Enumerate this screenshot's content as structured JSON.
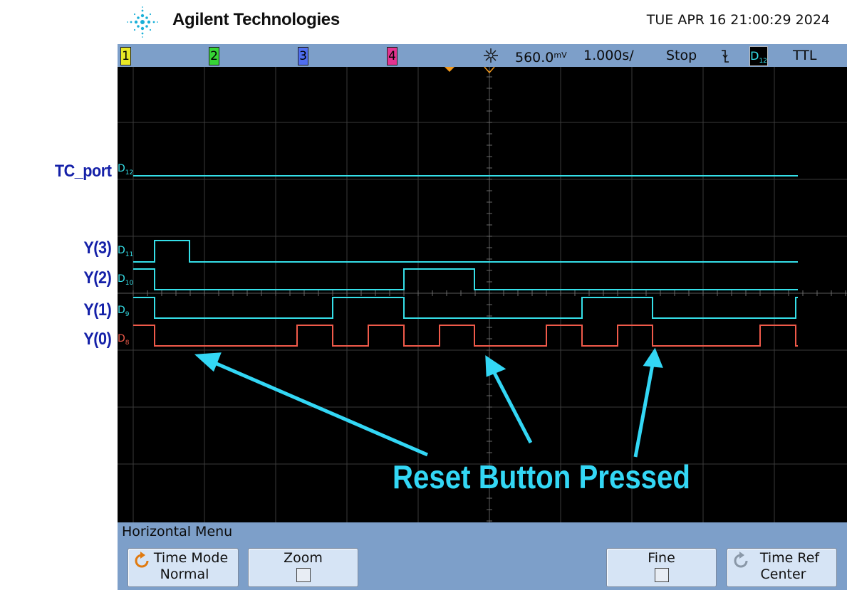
{
  "header": {
    "brand": "Agilent Technologies",
    "datetime": "TUE APR 16 21:00:29 2024",
    "logo_icon": "agilent-spark-icon"
  },
  "status_bar": {
    "channels": [
      "1",
      "2",
      "3",
      "4"
    ],
    "acquisition_icon": "acquisition-icon",
    "trigger_level": "560.0",
    "trigger_level_unit": "mV",
    "timebase": "1.000s/",
    "run_state": "Stop",
    "trigger_slope_icon": "falling-edge-icon",
    "trigger_source": "D",
    "trigger_source_sub": "12",
    "logic_threshold": "TTL"
  },
  "signals": [
    {
      "name": "TC_port",
      "channel": "D",
      "sub": "12"
    },
    {
      "name": "Y(3)",
      "channel": "D",
      "sub": "11"
    },
    {
      "name": "Y(2)",
      "channel": "D",
      "sub": "10"
    },
    {
      "name": "Y(1)",
      "channel": "D",
      "sub": "9"
    },
    {
      "name": "Y(0)",
      "channel": "D",
      "sub": "8"
    }
  ],
  "annotation": {
    "text": "Reset Button Pressed",
    "color": "#33d7f5"
  },
  "colors": {
    "trace_cyan": "#35dfe8",
    "trace_red": "#f05a4a",
    "label_blue": "#1420a8",
    "menu_bg": "#7d9fc9"
  },
  "menu": {
    "title": "Horizontal Menu",
    "softkeys": [
      {
        "line1": "Time Mode",
        "line2": "Normal",
        "icon": "rotate-knob-icon"
      },
      {
        "line1": "Zoom",
        "line2": ""
      },
      {
        "line1": "Fine",
        "line2": ""
      },
      {
        "line1": "Time Ref",
        "line2": "Center",
        "icon": "rotate-knob-icon"
      }
    ]
  }
}
